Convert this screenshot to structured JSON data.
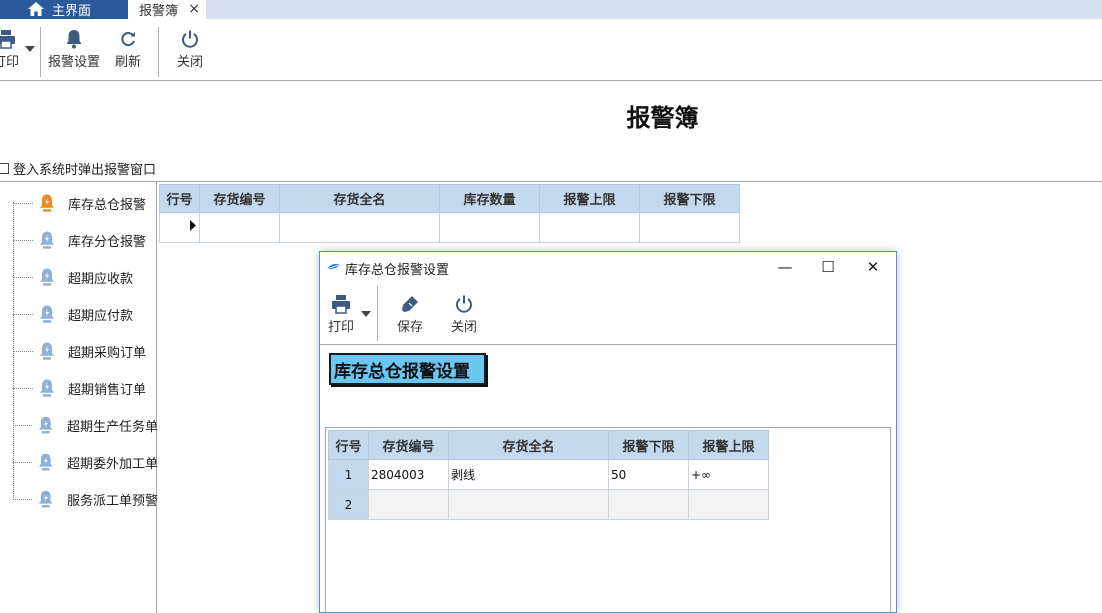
{
  "tabs": [
    {
      "label": "主界面",
      "icon": "home-icon"
    },
    {
      "label": "报警簿",
      "close": "×"
    }
  ],
  "toolbar": {
    "print_label": "打印",
    "alarm_settings_label": "报警设置",
    "refresh_label": "刷新",
    "close_label": "关闭"
  },
  "page_title": "报警簿",
  "popup_option": {
    "label": "登入系统时弹出报警窗口",
    "checked": false
  },
  "tree": {
    "items": [
      {
        "label": "库存总仓报警",
        "active": true
      },
      {
        "label": "库存分仓报警"
      },
      {
        "label": "超期应收款"
      },
      {
        "label": "超期应付款"
      },
      {
        "label": "超期采购订单"
      },
      {
        "label": "超期销售订单"
      },
      {
        "label": "超期生产任务单"
      },
      {
        "label": "超期委外加工单"
      },
      {
        "label": "服务派工单预警"
      }
    ]
  },
  "main_grid": {
    "headers": [
      "行号",
      "存货编号",
      "存货全名",
      "库存数量",
      "报警上限",
      "报警下限"
    ]
  },
  "dialog": {
    "title": "库存总仓报警设置",
    "minimize": "—",
    "maximize": "☐",
    "close": "✕",
    "toolbar": {
      "print_label": "打印",
      "save_label": "保存",
      "close_label": "关闭"
    },
    "heading": "库存总仓报警设置",
    "grid": {
      "headers": [
        "行号",
        "存货编号",
        "存货全名",
        "报警下限",
        "报警上限"
      ],
      "rows": [
        {
          "row_no": "1",
          "code": "2804003",
          "name": "剥线",
          "lower": "50",
          "upper": "+∞"
        },
        {
          "row_no": "2",
          "code": "",
          "name": "",
          "lower": "",
          "upper": ""
        }
      ]
    }
  },
  "colors": {
    "tab_active": "#2b5a9c",
    "grid_header": "#c5d9ee",
    "heading_bg": "#6cc6f2",
    "active_bell": "#f08a1c",
    "bell": "#8fb1d8"
  }
}
